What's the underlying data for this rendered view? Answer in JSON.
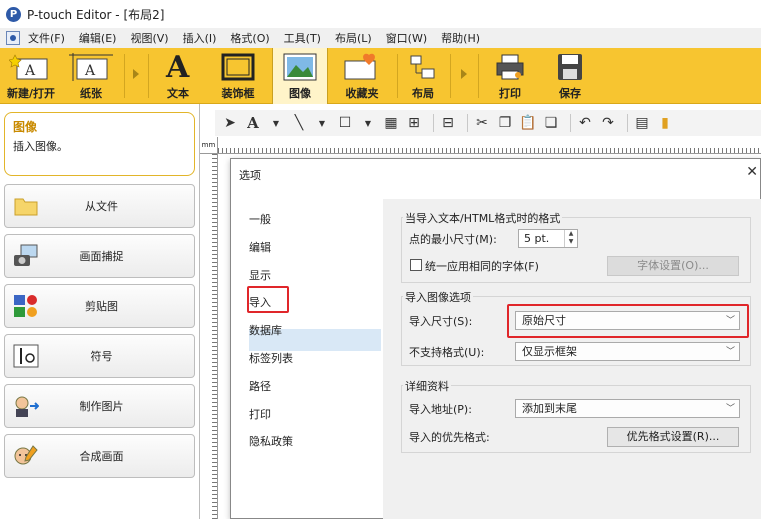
{
  "window": {
    "title": "P-touch Editor - [布局2]",
    "logo_letter": "P"
  },
  "menu": {
    "items": [
      "文件(F)",
      "编辑(E)",
      "视图(V)",
      "插入(I)",
      "格式(O)",
      "工具(T)",
      "布局(L)",
      "窗口(W)",
      "帮助(H)"
    ]
  },
  "ribbon": {
    "new_open": "新建/打开",
    "paper": "纸张",
    "text": "文本",
    "frame": "装饰框",
    "image": "图像",
    "favorites": "收藏夹",
    "layout": "布局",
    "print": "打印",
    "save": "保存",
    "text_icon": "A"
  },
  "left_panel": {
    "info_title": "图像",
    "info_desc": "插入图像。",
    "buttons": [
      "从文件",
      "画面捕捉",
      "剪贴图",
      "符号",
      "制作图片",
      "合成画面"
    ]
  },
  "ruler": {
    "unit": "mm"
  },
  "toolbar": {
    "text_tool": "A"
  },
  "dialog": {
    "title": "选项",
    "close": "✕",
    "nav": [
      "一般",
      "编辑",
      "显示",
      "导入",
      "数据库",
      "标签列表",
      "路径",
      "打印",
      "隐私政策"
    ],
    "text_group": {
      "label": "当导入文本/HTML格式时的格式",
      "min_size_label": "点的最小尺寸(M):",
      "min_size_value": "5 pt.",
      "same_font_label": "统一应用相同的字体(F)",
      "font_settings_button": "字体设置(O)..."
    },
    "image_group": {
      "label": "导入图像选项",
      "import_size_label": "导入尺寸(S):",
      "import_size_value": "原始尺寸",
      "unsupported_label": "不支持格式(U):",
      "unsupported_value": "仅显示框架"
    },
    "detail_group": {
      "label": "详细资料",
      "import_address_label": "导入地址(P):",
      "import_address_value": "添加到末尾",
      "priority_label": "导入的优先格式:",
      "priority_button": "优先格式设置(R)..."
    }
  },
  "colors": {
    "ribbon": "#f7c530",
    "highlight": "#e0262a",
    "accent_title": "#c98a00"
  }
}
